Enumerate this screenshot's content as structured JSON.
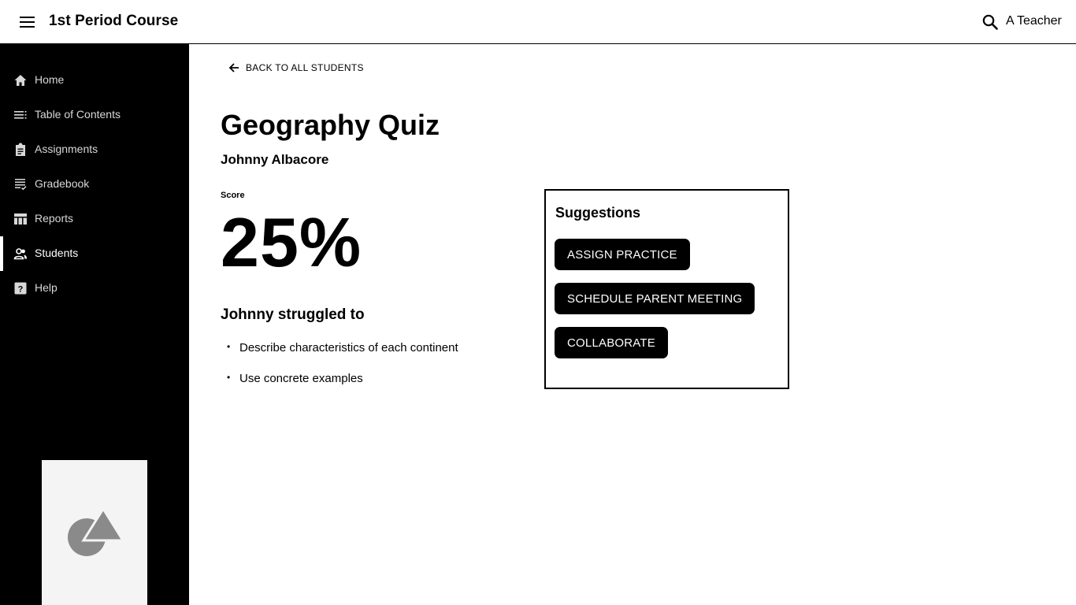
{
  "header": {
    "course_title": "1st Period Course",
    "user_name": "A Teacher",
    "menu_icon": "menu-icon",
    "search_icon": "search-icon"
  },
  "sidebar": {
    "items": [
      {
        "label": "Home",
        "icon": "home-icon",
        "active": false
      },
      {
        "label": "Table of Contents",
        "icon": "list-icon",
        "active": false
      },
      {
        "label": "Assignments",
        "icon": "clipboard-icon",
        "active": false
      },
      {
        "label": "Gradebook",
        "icon": "checklist-icon",
        "active": false
      },
      {
        "label": "Reports",
        "icon": "table-icon",
        "active": false
      },
      {
        "label": "Students",
        "icon": "people-icon",
        "active": true
      },
      {
        "label": "Help",
        "icon": "help-icon",
        "active": false
      }
    ]
  },
  "main": {
    "back_link": "BACK TO ALL STUDENTS",
    "quiz_title": "Geography Quiz",
    "student_name": "Johnny Albacore",
    "score_label": "Score",
    "score_value": "25%",
    "struggle_heading": "Johnny struggled to",
    "struggles": [
      "Describe characteristics of each continent",
      "Use concrete examples"
    ]
  },
  "suggestions": {
    "title": "Suggestions",
    "buttons": [
      "ASSIGN PRACTICE",
      "SCHEDULE PARENT MEETING",
      "COLLABORATE"
    ]
  },
  "colors": {
    "sidebar_bg": "#000000",
    "button_bg": "#000000",
    "promo_bg": "#f4f4f4",
    "promo_shape": "#8a8a8a"
  }
}
